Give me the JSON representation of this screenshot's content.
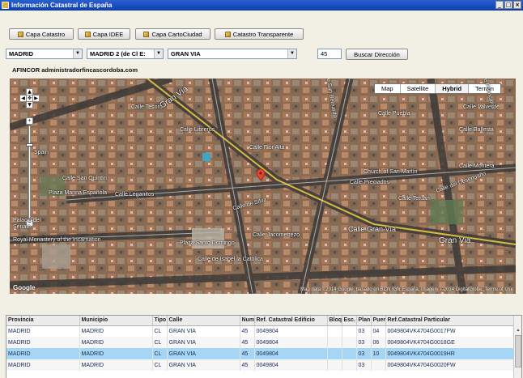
{
  "window": {
    "title": "Información Catastral de España",
    "controls": [
      "_",
      "□",
      "×"
    ]
  },
  "toolbar": {
    "buttons": [
      "Capa Catastro",
      "Capa IDEE",
      "Capa CartoCiudad",
      "Catastro Transparente"
    ]
  },
  "search": {
    "provincia": "MADRID",
    "municipio": "MADRID 2 (de Cl E:",
    "calle": "GRAN VIA",
    "numero": "45",
    "button_label": "Buscar Dirección"
  },
  "address_caption": "AFINCOR administradorfincascordoba.com",
  "map": {
    "types": [
      "Map",
      "Satellite",
      "Hybrid",
      "Terrain"
    ],
    "active_type": "Hybrid",
    "zoom_fraction": 0.2,
    "labels": [
      "Gran Vía",
      "Calle Flor Alta",
      "Calle de Silva",
      "Calle Jacometrezo",
      "Calle Gran Vía",
      "Gran Via",
      "Plaza Santo Domingo",
      "Calle Leganitos",
      "Calle de Isabel la Católica",
      "Plaza Marina Española",
      "Calle de San Bernardo",
      "Calle Preciados",
      "Royal Monastery of the Incarnation",
      "Calle Tetuán",
      "Calle Libreros",
      "Spain",
      "Senate",
      "Palacio del",
      "Church of San Martín",
      "Calle del Desengaño",
      "Calle Ballesta",
      "Calle Montera",
      "Calle Valverde",
      "Calle Fuencarral",
      "Calle Puebla",
      "Calle San Quintín",
      "Calle Tesoro"
    ],
    "attribution": "Map data ©2014 Google, basado en BCN IGN España, Imagery ©2014 DigitalGlobe, Terms of Use",
    "logo": "Google"
  },
  "table": {
    "columns": [
      "Provincia",
      "Municipio",
      "Tipo",
      "Calle",
      "Num",
      "Ref. Catastral Edificio",
      "Bloq",
      "Esc.",
      "Plan",
      "Puer",
      "Ref.Catastral Particular"
    ],
    "rows": [
      [
        "MADRID",
        "MADRID",
        "CL",
        "GRAN VIA",
        "45",
        "0049804",
        "",
        "",
        "03",
        "04",
        "0049804VK4704G0017FW"
      ],
      [
        "MADRID",
        "MADRID",
        "CL",
        "GRAN VIA",
        "45",
        "0049804",
        "",
        "",
        "03",
        "06",
        "0049804VK4704G0018GE"
      ],
      [
        "MADRID",
        "MADRID",
        "CL",
        "GRAN VIA",
        "45",
        "0049804",
        "",
        "",
        "03",
        "10",
        "0049804VK4704G0019HR"
      ],
      [
        "MADRID",
        "MADRID",
        "CL",
        "GRAN VIA",
        "45",
        "0049804",
        "",
        "",
        "03",
        "",
        "0049804VK4704G0020FW"
      ]
    ],
    "selected_row": 2
  }
}
